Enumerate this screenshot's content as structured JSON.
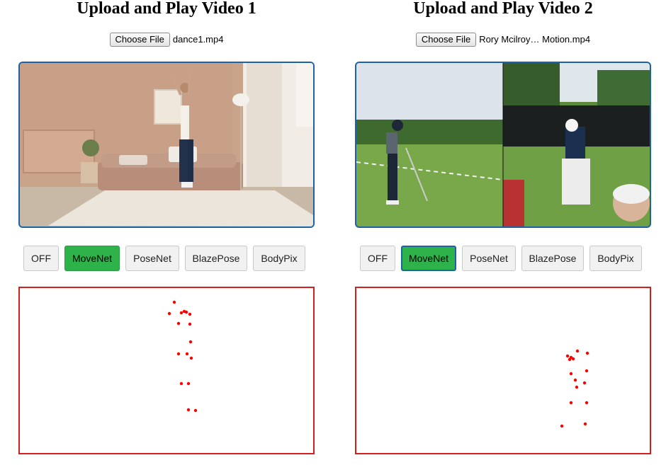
{
  "panels": [
    {
      "title": "Upload and Play Video 1",
      "file_button": "Choose File",
      "file_name": "dance1.mp4",
      "models": [
        "OFF",
        "MoveNet",
        "PoseNet",
        "BlazePose",
        "BodyPix"
      ],
      "active_model": "MoveNet"
    },
    {
      "title": "Upload and Play Video 2",
      "file_button": "Choose File",
      "file_name": "Rory Mcilroy… Motion.mp4",
      "models": [
        "OFF",
        "MoveNet",
        "PoseNet",
        "BlazePose",
        "BodyPix"
      ],
      "active_model": "MoveNet"
    }
  ],
  "colors": {
    "accent_active": "#2db34a",
    "focus_border": "#1f62a3",
    "canvas_border": "#d21f1f",
    "keypoint": "#ff0000"
  }
}
